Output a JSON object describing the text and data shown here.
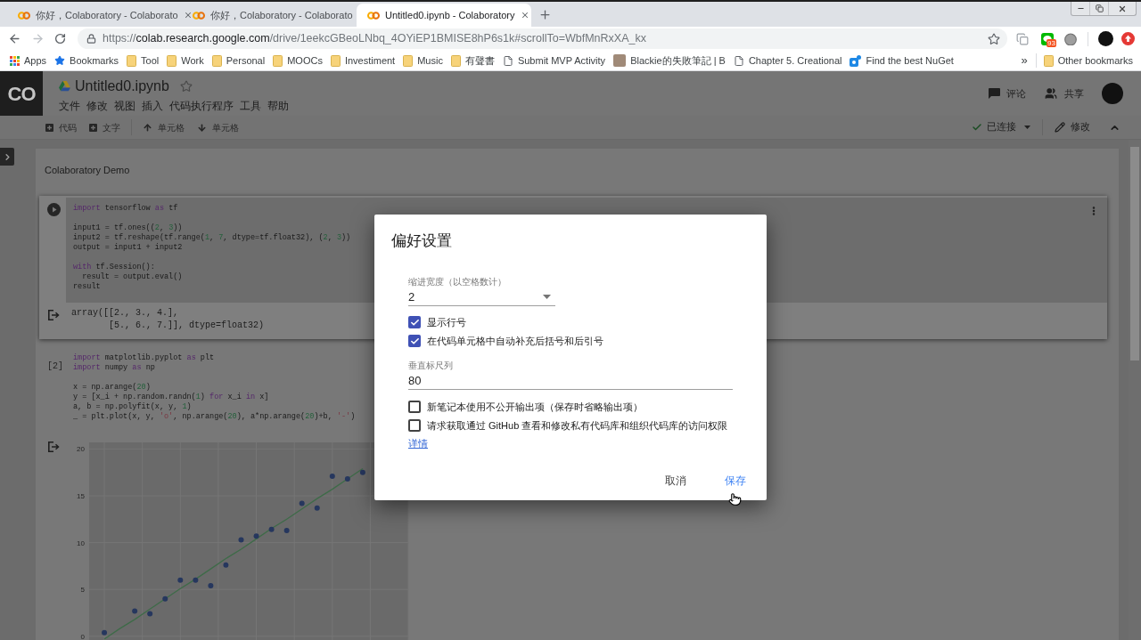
{
  "browser": {
    "tabs": [
      {
        "title": "你好，Colaboratory - Colaborato",
        "selected": false
      },
      {
        "title": "你好，Colaboratory - Colaborato",
        "selected": false
      },
      {
        "title": "Untitled0.ipynb - Colaboratory",
        "selected": true
      }
    ],
    "address": {
      "scheme": "https://",
      "host": "colab.research.google.com",
      "path": "/drive/1eekcGBeoLNbq_4OYiEP1BMISE8hP6s1k#scrollTo=WbfMnRxXA_kx"
    },
    "extension_badge": "93",
    "bookmarks": [
      {
        "label": "Apps",
        "kind": "apps"
      },
      {
        "label": "Bookmarks",
        "kind": "star"
      },
      {
        "label": "Tool",
        "kind": "folder"
      },
      {
        "label": "Work",
        "kind": "folder"
      },
      {
        "label": "Personal",
        "kind": "folder"
      },
      {
        "label": "MOOCs",
        "kind": "folder"
      },
      {
        "label": "Investiment",
        "kind": "folder"
      },
      {
        "label": "Music",
        "kind": "folder"
      },
      {
        "label": "有聲書",
        "kind": "folder"
      },
      {
        "label": "Submit MVP Activity",
        "kind": "page"
      },
      {
        "label": "Blackie的失敗筆記 | B",
        "kind": "photo"
      },
      {
        "label": "Chapter 5. Creational",
        "kind": "page"
      },
      {
        "label": "Find the best NuGet",
        "kind": "site"
      }
    ],
    "bookmarks_overflow": "»",
    "other_bookmarks": {
      "label": "Other bookmarks",
      "kind": "folder"
    }
  },
  "colab": {
    "logo": "CO",
    "title": "Untitled0.ipynb",
    "menu": [
      "文件",
      "修改",
      "视图",
      "插入",
      "代码执行程序",
      "工具",
      "帮助"
    ],
    "actions": [
      {
        "label": "评论",
        "kind": "comment"
      },
      {
        "label": "共享",
        "kind": "share"
      }
    ],
    "toolbar": [
      {
        "label": "代码",
        "kind": "add"
      },
      {
        "label": "文字",
        "kind": "add"
      },
      {
        "label": "单元格",
        "kind": "up"
      },
      {
        "label": "单元格",
        "kind": "down"
      }
    ],
    "connection": "已连接",
    "edit": "修改",
    "cells": [
      {
        "kind": "text",
        "text": "Colaboratory Demo"
      },
      {
        "kind": "code",
        "selected": true,
        "blocks": [
          [
            [
              {
                "text": "import",
                "kind": "keyword"
              },
              {
                "text": " tensorflow ",
                "kind": "plain"
              },
              {
                "text": "as",
                "kind": "keyword"
              },
              {
                "text": " tf",
                "kind": "plain"
              }
            ]
          ],
          [
            [
              {
                "text": "input1 = tf.ones((",
                "kind": "plain"
              },
              {
                "text": "2",
                "kind": "number"
              },
              {
                "text": ", ",
                "kind": "plain"
              },
              {
                "text": "3",
                "kind": "number"
              },
              {
                "text": "))",
                "kind": "plain"
              }
            ],
            [
              {
                "text": "input2 = tf.reshape(tf.range(",
                "kind": "plain"
              },
              {
                "text": "1",
                "kind": "number"
              },
              {
                "text": ", ",
                "kind": "plain"
              },
              {
                "text": "7",
                "kind": "number"
              },
              {
                "text": ", dtype=tf.float32), (",
                "kind": "plain"
              },
              {
                "text": "2",
                "kind": "number"
              },
              {
                "text": ", ",
                "kind": "plain"
              },
              {
                "text": "3",
                "kind": "number"
              },
              {
                "text": "))",
                "kind": "plain"
              }
            ],
            [
              {
                "text": "output = input1 + input2",
                "kind": "plain"
              }
            ]
          ],
          [
            [
              {
                "text": "with",
                "kind": "keyword"
              },
              {
                "text": " tf.Session():",
                "kind": "plain"
              }
            ],
            [
              {
                "text": "  result = output.eval()",
                "kind": "plain"
              }
            ],
            [
              {
                "text": "result",
                "kind": "plain"
              }
            ]
          ]
        ],
        "output": {
          "kind": "text",
          "text": "array([[2., 3., 4.],\n       [5., 6., 7.]], dtype=float32)"
        }
      },
      {
        "kind": "code",
        "selected": false,
        "count": "[2]",
        "blocks": [
          [
            [
              {
                "text": "import",
                "kind": "keyword"
              },
              {
                "text": " matplotlib.pyplot ",
                "kind": "plain"
              },
              {
                "text": "as",
                "kind": "keyword"
              },
              {
                "text": " plt",
                "kind": "plain"
              }
            ],
            [
              {
                "text": "import",
                "kind": "keyword"
              },
              {
                "text": " numpy ",
                "kind": "plain"
              },
              {
                "text": "as",
                "kind": "keyword"
              },
              {
                "text": " np",
                "kind": "plain"
              }
            ]
          ],
          [
            [
              {
                "text": "x = np.arange(",
                "kind": "plain"
              },
              {
                "text": "20",
                "kind": "number"
              },
              {
                "text": ")",
                "kind": "plain"
              }
            ],
            [
              {
                "text": "y = [x_i + np.random.randn(",
                "kind": "plain"
              },
              {
                "text": "1",
                "kind": "number"
              },
              {
                "text": ") ",
                "kind": "plain"
              },
              {
                "text": "for",
                "kind": "keyword"
              },
              {
                "text": " x_i ",
                "kind": "plain"
              },
              {
                "text": "in",
                "kind": "keyword"
              },
              {
                "text": " x]",
                "kind": "plain"
              }
            ],
            [
              {
                "text": "a, b = np.polyfit(x, y, ",
                "kind": "plain"
              },
              {
                "text": "1",
                "kind": "number"
              },
              {
                "text": ")",
                "kind": "plain"
              }
            ],
            [
              {
                "text": "_ = plt.plot(x, y, ",
                "kind": "plain"
              },
              {
                "text": "'o'",
                "kind": "string"
              },
              {
                "text": ", np.arange(",
                "kind": "plain"
              },
              {
                "text": "20",
                "kind": "number"
              },
              {
                "text": "), a*np.arange(",
                "kind": "plain"
              },
              {
                "text": "20",
                "kind": "number"
              },
              {
                "text": ")+b, ",
                "kind": "plain"
              },
              {
                "text": "'-'",
                "kind": "string"
              },
              {
                "text": ")",
                "kind": "plain"
              }
            ]
          ]
        ],
        "output": {
          "kind": "chart",
          "chart_data": {
            "type": "scatter",
            "grid": true,
            "categories": [
              null,
              null,
              null,
              null,
              null,
              null,
              null,
              null,
              null,
              null,
              null,
              null,
              null,
              null,
              null,
              null,
              null,
              null,
              null
            ],
            "ylim": [
              -0.3,
              20.7
            ],
            "yticks": [
              0,
              5,
              10,
              15,
              20
            ],
            "series": [
              {
                "type": "scatter",
                "color": "#26375e",
                "values": [
                  0.4,
                  null,
                  2.7,
                  2.4,
                  4.0,
                  6.0,
                  6.0,
                  5.4,
                  7.6,
                  10.3,
                  10.7,
                  11.4,
                  11.3,
                  14.2,
                  13.7,
                  17.1,
                  16.8,
                  17.5,
                  null
                ]
              },
              {
                "type": "line",
                "color": "#3e6b48",
                "values": [
                  -0.3,
                  0.8,
                  1.8,
                  2.9,
                  4.0,
                  5.1,
                  6.1,
                  7.2,
                  8.3,
                  9.3,
                  10.4,
                  11.5,
                  12.5,
                  13.6,
                  14.7,
                  15.7,
                  16.8,
                  17.9,
                  null
                ]
              }
            ]
          }
        }
      }
    ]
  },
  "dialog": {
    "title": "偏好设置",
    "items": [
      {
        "kind": "select",
        "label": "缩进宽度（以空格数计）",
        "value": "2"
      },
      {
        "kind": "checkbox",
        "label": "显示行号",
        "checked": true
      },
      {
        "kind": "checkbox",
        "label": "在代码单元格中自动补充后括号和后引号",
        "checked": true
      },
      {
        "kind": "field",
        "label": "垂直标尺列",
        "value": "80"
      },
      {
        "kind": "checkbox",
        "label": "新笔记本使用不公开输出项（保存时省略输出项）",
        "checked": false
      },
      {
        "kind": "checkbox",
        "label": "请求获取通过 GitHub 查看和修改私有代码库和组织代码库的访问权限",
        "checked": false
      },
      {
        "kind": "link",
        "label": "详情"
      }
    ],
    "buttons": [
      {
        "label": "取消",
        "kind": "plain"
      },
      {
        "label": "保存",
        "kind": "primary"
      }
    ]
  }
}
